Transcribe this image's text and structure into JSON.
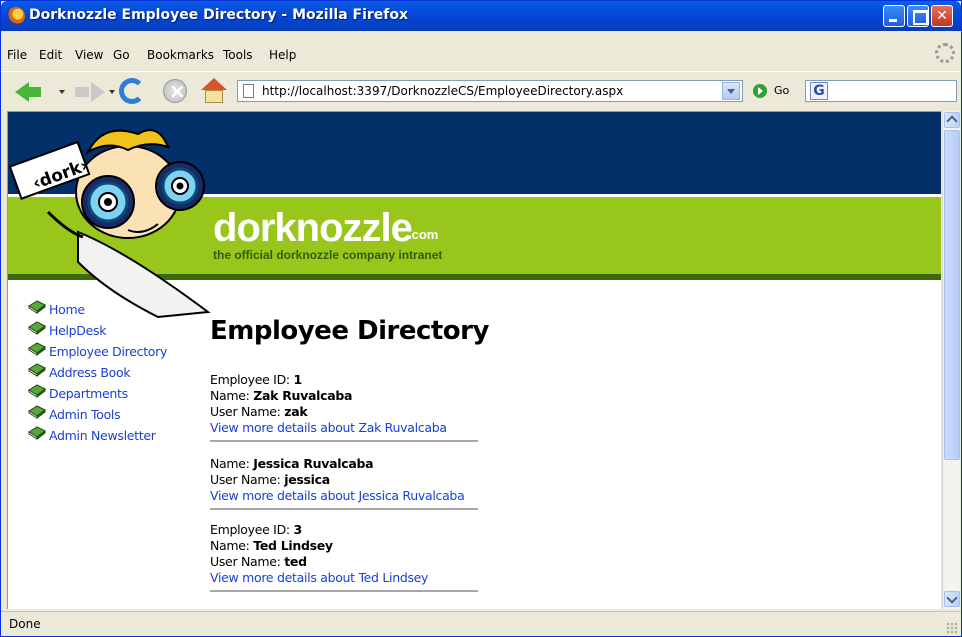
{
  "window": {
    "title": "Dorknozzle Employee Directory - Mozilla Firefox"
  },
  "menu": {
    "items": [
      "File",
      "Edit",
      "View",
      "Go",
      "Bookmarks",
      "Tools",
      "Help"
    ]
  },
  "toolbar": {
    "url": "http://localhost:3397/DorknozzleCS/EmployeeDirectory.aspx",
    "go_label": "Go",
    "search_icon_letter": "G"
  },
  "site": {
    "name": "dorknozzle",
    "dotcom": ".com",
    "tagline": "the official dorknozzle company intranet",
    "sign_text": "‹dork›",
    "colors": {
      "header_dark": "#043069",
      "header_green": "#99c61a",
      "link": "#1a3fd1"
    }
  },
  "nav": {
    "items": [
      {
        "label": "Home"
      },
      {
        "label": "HelpDesk"
      },
      {
        "label": "Employee Directory"
      },
      {
        "label": "Address Book"
      },
      {
        "label": "Departments"
      },
      {
        "label": "Admin Tools"
      },
      {
        "label": "Admin Newsletter"
      }
    ]
  },
  "main": {
    "title": "Employee Directory",
    "employees": [
      {
        "id_label": "Employee ID: ",
        "id": "1",
        "name_label": "Name: ",
        "name": "Zak Ruvalcaba",
        "user_label": "User Name: ",
        "user": "zak",
        "link": "View more details about Zak Ruvalcaba"
      },
      {
        "name_label": "Name: ",
        "name": "Jessica Ruvalcaba",
        "user_label": "User Name: ",
        "user": "jessica",
        "link": "View more details about Jessica Ruvalcaba"
      },
      {
        "id_label": "Employee ID: ",
        "id": "3",
        "name_label": "Name: ",
        "name": "Ted Lindsey",
        "user_label": "User Name: ",
        "user": "ted",
        "link": "View more details about Ted Lindsey"
      }
    ]
  },
  "status": {
    "text": "Done"
  }
}
